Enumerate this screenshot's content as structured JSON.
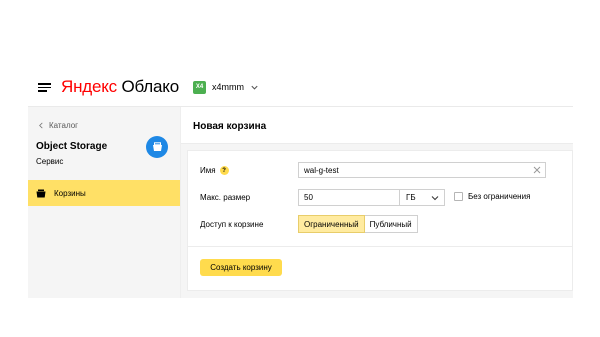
{
  "header": {
    "logo_brand": "Яндекс",
    "logo_product": "Облако",
    "cloud": {
      "badge": "X4",
      "name": "x4mmm"
    }
  },
  "sidebar": {
    "back_label": "Каталог",
    "service_title": "Object Storage",
    "service_subtitle": "Сервис",
    "items": [
      {
        "label": "Корзины",
        "icon": "bucket-icon",
        "active": true
      }
    ]
  },
  "main": {
    "title": "Новая корзина",
    "form": {
      "name": {
        "label": "Имя",
        "help": "?",
        "value": "wal-g-test"
      },
      "max_size": {
        "label": "Макс. размер",
        "value": "50",
        "unit": "ГБ",
        "unlimited_label": "Без ограничения",
        "unlimited_checked": false
      },
      "access": {
        "label": "Доступ к корзине",
        "options": [
          "Ограниченный",
          "Публичный"
        ],
        "selected": "Ограниченный"
      },
      "submit_label": "Создать корзину"
    }
  },
  "colors": {
    "accent": "#ffdb4d",
    "brand_red": "#ff0000",
    "service_blue": "#1e88e5",
    "cloud_badge": "#4caf50",
    "selected_option": "#ffeba0"
  }
}
